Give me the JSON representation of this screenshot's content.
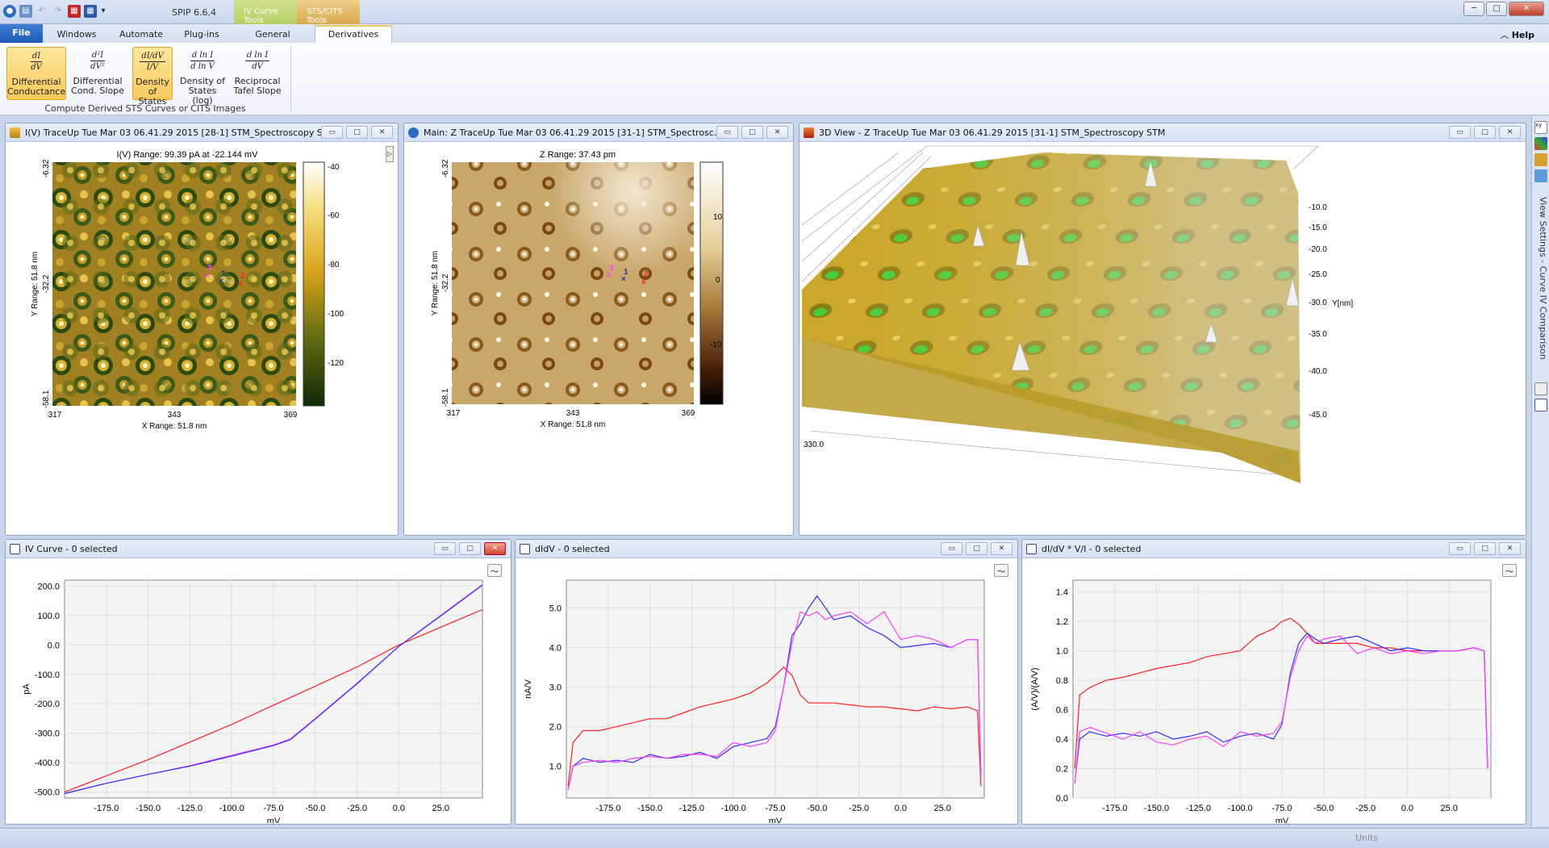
{
  "app": {
    "title": "SPIP 6.6.4"
  },
  "context_tabs": [
    {
      "label": "IV Curve Tools",
      "color": "#b8d36a"
    },
    {
      "label": "STS/CITS Tools",
      "color": "#e0b860"
    }
  ],
  "tabs": {
    "file": "File",
    "windows": "Windows",
    "automate": "Automate",
    "plugins": "Plug-ins",
    "general": "General",
    "derivatives": "Derivatives",
    "help": "Help"
  },
  "ribbon": {
    "buttons": [
      {
        "label1": "Differential",
        "label2": "Conductance",
        "selected": true
      },
      {
        "label1": "Differential",
        "label2": "Cond. Slope",
        "selected": false
      },
      {
        "label1": "Density",
        "label2": "of States",
        "selected": true
      },
      {
        "label1": "Density of",
        "label2": "States (log)",
        "selected": false
      },
      {
        "label1": "Reciprocal",
        "label2": "Tafel Slope",
        "selected": false
      }
    ],
    "group_label": "Compute Derived STS Curves or CITS Images"
  },
  "windows": {
    "iv_image": {
      "title": "I(V) TraceUp Tue Mar 03 06.41.29 2015 [28-1]  STM_Spectroscopy S...",
      "range_label": "I(V) Range:  99.39 pA at -22.144 mV",
      "x_ticks": [
        "317",
        "343",
        "369"
      ],
      "x_label": "X Range:  51.8 nm",
      "y_ticks": [
        "-6.32",
        "-32.2",
        "-58.1"
      ],
      "y_label": "Y Range:  51.8 nm",
      "cbar_ticks": [
        "-40",
        "-60",
        "-80",
        "-100",
        "-120"
      ]
    },
    "z_image": {
      "title": "Main: Z TraceUp Tue Mar 03 06.41.29 2015 [31-1]  STM_Spectrosc...",
      "range_label": "Z Range:  37.43 pm",
      "x_ticks": [
        "317",
        "343",
        "369"
      ],
      "x_label": "X Range:  51.8 nm",
      "y_ticks": [
        "-6.32",
        "-32.2",
        "-58.1"
      ],
      "y_label": "Y Range:  51.8 nm",
      "cbar_ticks": [
        "10",
        "0",
        "-10"
      ]
    },
    "view3d": {
      "title": "3D View - Z TraceUp Tue Mar 03 06.41.29 2015 [31-1]  STM_Spectroscopy STM",
      "y_ticks": [
        "-10.0",
        "-15.0",
        "-20.0",
        "-25.0",
        "-30.0",
        "-35.0",
        "-40.0",
        "-45.0"
      ],
      "y_label": "Y[nm]",
      "x_tick": "330.0"
    },
    "iv_curve": {
      "title": "IV Curve - 0 selected"
    },
    "didv": {
      "title": "dIdV - 0 selected"
    },
    "dos": {
      "title": "dI/dV * V/I - 0 selected"
    }
  },
  "markers": [
    "1",
    "2",
    "3"
  ],
  "side_label": "View Settings - Curve IV Comparison",
  "status": {
    "units": "Units"
  },
  "chart_data": [
    {
      "type": "line",
      "title": "IV Curve - 0 selected",
      "xlabel": "mV",
      "ylabel": "pA",
      "xlim": [
        -200,
        50
      ],
      "ylim": [
        -520,
        220
      ],
      "x_ticks": [
        -175,
        -150,
        -125,
        -100,
        -75,
        -50,
        -25,
        0,
        25
      ],
      "y_ticks": [
        200,
        100,
        0,
        -100,
        -200,
        -300,
        -400,
        -500
      ],
      "y_tick_labels": [
        "200.0",
        "100.0",
        "0.0",
        "-100.0",
        "-200.0",
        "-300.0",
        "-400.0",
        "-500.0"
      ],
      "x_tick_labels": [
        "-175.0",
        "-150.0",
        "-125.0",
        "-100.0",
        "-75.0",
        "-50.0",
        "-25.0",
        "0.0",
        "25.0"
      ],
      "series": [
        {
          "color": "#ff2020",
          "x": [
            -200,
            -175,
            -150,
            -125,
            -100,
            -75,
            -50,
            -25,
            0,
            25,
            50
          ],
          "y": [
            -500,
            -445,
            -390,
            -330,
            -270,
            -205,
            -140,
            -75,
            0,
            60,
            120
          ]
        },
        {
          "color": "#ff40ff",
          "x": [
            -200,
            -175,
            -150,
            -125,
            -100,
            -75,
            -65,
            -50,
            -25,
            0,
            25,
            50
          ],
          "y": [
            -505,
            -470,
            -440,
            -410,
            -375,
            -340,
            -320,
            -250,
            -130,
            -5,
            100,
            205
          ]
        },
        {
          "color": "#3030ff",
          "x": [
            -200,
            -175,
            -150,
            -125,
            -100,
            -75,
            -65,
            -50,
            -25,
            0,
            25,
            50
          ],
          "y": [
            -505,
            -470,
            -440,
            -412,
            -378,
            -342,
            -322,
            -252,
            -132,
            -5,
            98,
            203
          ]
        }
      ]
    },
    {
      "type": "line",
      "title": "dIdV - 0 selected",
      "xlabel": "mV",
      "ylabel": "nA/V",
      "xlim": [
        -200,
        50
      ],
      "ylim": [
        0.2,
        5.7
      ],
      "x_ticks": [
        -175,
        -150,
        -125,
        -100,
        -75,
        -50,
        -25,
        0,
        25
      ],
      "y_ticks": [
        1,
        2,
        3,
        4,
        5
      ],
      "y_tick_labels": [
        "1.0",
        "2.0",
        "3.0",
        "4.0",
        "5.0"
      ],
      "x_tick_labels": [
        "-175.0",
        "-150.0",
        "-125.0",
        "-100.0",
        "-75.0",
        "-50.0",
        "-25.0",
        "0.0",
        "25.0"
      ],
      "series": [
        {
          "color": "#ff2020",
          "x": [
            -199,
            -196,
            -190,
            -180,
            -170,
            -160,
            -150,
            -140,
            -130,
            -120,
            -110,
            -100,
            -90,
            -80,
            -75,
            -70,
            -65,
            -60,
            -55,
            -50,
            -40,
            -30,
            -20,
            -10,
            0,
            10,
            20,
            30,
            40,
            46,
            48
          ],
          "y": [
            0.5,
            1.6,
            1.9,
            1.9,
            2.0,
            2.1,
            2.2,
            2.2,
            2.35,
            2.5,
            2.6,
            2.7,
            2.85,
            3.1,
            3.3,
            3.5,
            3.3,
            2.8,
            2.6,
            2.6,
            2.6,
            2.55,
            2.5,
            2.5,
            2.45,
            2.4,
            2.5,
            2.45,
            2.5,
            2.4,
            0.5
          ]
        },
        {
          "color": "#3030ff",
          "x": [
            -199,
            -196,
            -190,
            -180,
            -170,
            -160,
            -150,
            -140,
            -130,
            -120,
            -110,
            -100,
            -90,
            -80,
            -75,
            -70,
            -65,
            -60,
            -55,
            -50,
            -45,
            -40,
            -30,
            -20,
            -10,
            0,
            10,
            20,
            30,
            40,
            46,
            48
          ],
          "y": [
            0.4,
            1.0,
            1.2,
            1.1,
            1.15,
            1.1,
            1.3,
            1.2,
            1.25,
            1.35,
            1.2,
            1.5,
            1.6,
            1.7,
            2.0,
            3.0,
            4.3,
            4.6,
            5.0,
            5.3,
            5.0,
            4.7,
            4.8,
            4.5,
            4.3,
            4.0,
            4.05,
            4.1,
            4.0,
            4.2,
            4.2,
            0.7
          ]
        },
        {
          "color": "#ff40ff",
          "x": [
            -199,
            -196,
            -190,
            -180,
            -170,
            -160,
            -150,
            -140,
            -130,
            -120,
            -110,
            -100,
            -90,
            -80,
            -75,
            -70,
            -65,
            -60,
            -55,
            -50,
            -45,
            -40,
            -30,
            -20,
            -10,
            0,
            10,
            20,
            30,
            40,
            46,
            48
          ],
          "y": [
            0.4,
            1.0,
            1.1,
            1.15,
            1.1,
            1.2,
            1.25,
            1.2,
            1.3,
            1.3,
            1.25,
            1.6,
            1.5,
            1.6,
            1.9,
            3.0,
            4.1,
            4.9,
            4.8,
            4.9,
            4.7,
            4.8,
            4.9,
            4.6,
            4.9,
            4.2,
            4.3,
            4.2,
            4.0,
            4.2,
            4.2,
            0.7
          ]
        }
      ]
    },
    {
      "type": "line",
      "title": "dI/dV * V/I - 0 selected",
      "xlabel": "mV",
      "ylabel": "(A/V)/(A/V)",
      "xlim": [
        -200,
        50
      ],
      "ylim": [
        0,
        1.48
      ],
      "x_ticks": [
        -175,
        -150,
        -125,
        -100,
        -75,
        -50,
        -25,
        0,
        25
      ],
      "y_ticks": [
        0,
        0.2,
        0.4,
        0.6,
        0.8,
        1.0,
        1.2,
        1.4
      ],
      "y_tick_labels": [
        "0.0",
        "0.2",
        "0.4",
        "0.6",
        "0.8",
        "1.0",
        "1.2",
        "1.4"
      ],
      "x_tick_labels": [
        "-175.0",
        "-150.0",
        "-125.0",
        "-100.0",
        "-75.0",
        "-50.0",
        "-25.0",
        "0.0",
        "25.0"
      ],
      "series": [
        {
          "color": "#ff2020",
          "x": [
            -199,
            -196,
            -190,
            -180,
            -170,
            -160,
            -150,
            -140,
            -130,
            -120,
            -110,
            -100,
            -90,
            -80,
            -75,
            -70,
            -65,
            -60,
            -55,
            -50,
            -40,
            -30,
            -20,
            -10,
            0,
            10,
            20,
            30,
            40,
            46,
            48
          ],
          "y": [
            0.2,
            0.7,
            0.75,
            0.8,
            0.82,
            0.85,
            0.88,
            0.9,
            0.92,
            0.96,
            0.98,
            1.0,
            1.1,
            1.15,
            1.2,
            1.22,
            1.18,
            1.12,
            1.05,
            1.05,
            1.05,
            1.05,
            1.02,
            1.02,
            1.0,
            1.0,
            1.0,
            1.0,
            1.02,
            1.0,
            0.2
          ]
        },
        {
          "color": "#3030ff",
          "x": [
            -199,
            -196,
            -190,
            -180,
            -170,
            -160,
            -150,
            -140,
            -130,
            -120,
            -110,
            -100,
            -90,
            -80,
            -75,
            -70,
            -65,
            -60,
            -55,
            -50,
            -40,
            -30,
            -20,
            -10,
            0,
            10,
            20,
            30,
            40,
            46,
            48
          ],
          "y": [
            0.1,
            0.4,
            0.45,
            0.42,
            0.44,
            0.42,
            0.45,
            0.4,
            0.42,
            0.45,
            0.38,
            0.42,
            0.44,
            0.4,
            0.5,
            0.85,
            1.05,
            1.12,
            1.08,
            1.05,
            1.08,
            1.1,
            1.05,
            1.0,
            1.02,
            1.0,
            1.0,
            1.0,
            1.02,
            1.0,
            0.2
          ]
        },
        {
          "color": "#ff40ff",
          "x": [
            -199,
            -196,
            -190,
            -180,
            -170,
            -160,
            -150,
            -140,
            -130,
            -120,
            -110,
            -100,
            -90,
            -80,
            -75,
            -70,
            -65,
            -60,
            -55,
            -50,
            -40,
            -30,
            -20,
            -10,
            0,
            10,
            20,
            30,
            40,
            46,
            48
          ],
          "y": [
            0.1,
            0.45,
            0.48,
            0.44,
            0.4,
            0.45,
            0.38,
            0.36,
            0.4,
            0.42,
            0.35,
            0.45,
            0.42,
            0.44,
            0.52,
            0.82,
            1.0,
            1.1,
            1.05,
            1.08,
            1.1,
            0.98,
            1.02,
            0.98,
            1.0,
            0.98,
            1.0,
            1.0,
            1.02,
            1.0,
            0.2
          ]
        }
      ]
    }
  ]
}
